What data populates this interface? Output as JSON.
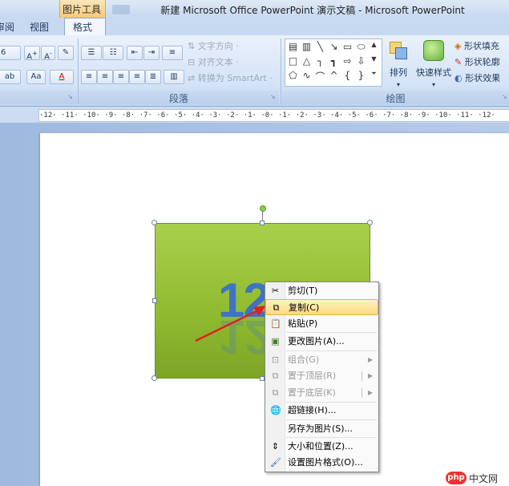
{
  "window": {
    "title": "新建 Microsoft Office PowerPoint 演示文稿 - Microsoft PowerPoint",
    "contextual_tab": "图片工具"
  },
  "tabs": [
    {
      "label": "审阅",
      "shown": "审阅"
    },
    {
      "label": "视图"
    },
    {
      "label": "格式"
    }
  ],
  "ribbon": {
    "font_group": {
      "font_size": "6"
    },
    "paragraph_group": {
      "label": "段落",
      "text_direction": "文字方向",
      "align_text": "对齐文本",
      "convert_smartart": "转换为 SmartArt"
    },
    "drawing_group": {
      "label": "绘图",
      "arrange": "排列",
      "quick_styles": "快速样式",
      "shape_fill": "形状填充",
      "shape_outline": "形状轮廓",
      "shape_effects": "形状效果"
    }
  },
  "ruler": {
    "text": "·12· ·11· ·10· ·9· ·8· ·7· ·6· ·5· ·4· ·3· ·2· ·1· ·0· ·1· ·2· ·3· ·4· ·5· ·6· ·7· ·8· ·9· ·10· ·11· ·12·"
  },
  "slide": {
    "picture_text": "12"
  },
  "context_menu": {
    "items": [
      {
        "label": "剪切(T)",
        "icon": "scissors-icon",
        "enabled": true
      },
      {
        "label": "复制(C)",
        "icon": "copy-icon",
        "enabled": true,
        "highlighted": true
      },
      {
        "label": "粘贴(P)",
        "icon": "paste-icon",
        "enabled": true
      },
      {
        "label": "更改图片(A)...",
        "icon": "change-picture-icon",
        "enabled": true
      },
      {
        "label": "组合(G)",
        "icon": "group-icon",
        "enabled": false,
        "submenu": true
      },
      {
        "label": "置于顶层(R)",
        "icon": "bring-to-front-icon",
        "enabled": false,
        "submenu": true
      },
      {
        "label": "置于底层(K)",
        "icon": "send-to-back-icon",
        "enabled": false,
        "submenu": true
      },
      {
        "label": "超链接(H)...",
        "icon": "hyperlink-icon",
        "enabled": true
      },
      {
        "label": "另存为图片(S)...",
        "icon": "",
        "enabled": true
      },
      {
        "label": "大小和位置(Z)...",
        "icon": "size-position-icon",
        "enabled": true
      },
      {
        "label": "设置图片格式(O)...",
        "icon": "format-picture-icon",
        "enabled": true
      }
    ]
  },
  "watermark": {
    "logo": "php",
    "text": "中文网"
  },
  "colors": {
    "picture_fill": "#8fba2f",
    "menu_highlight": "#fbd97f",
    "arrow": "#e02020"
  }
}
